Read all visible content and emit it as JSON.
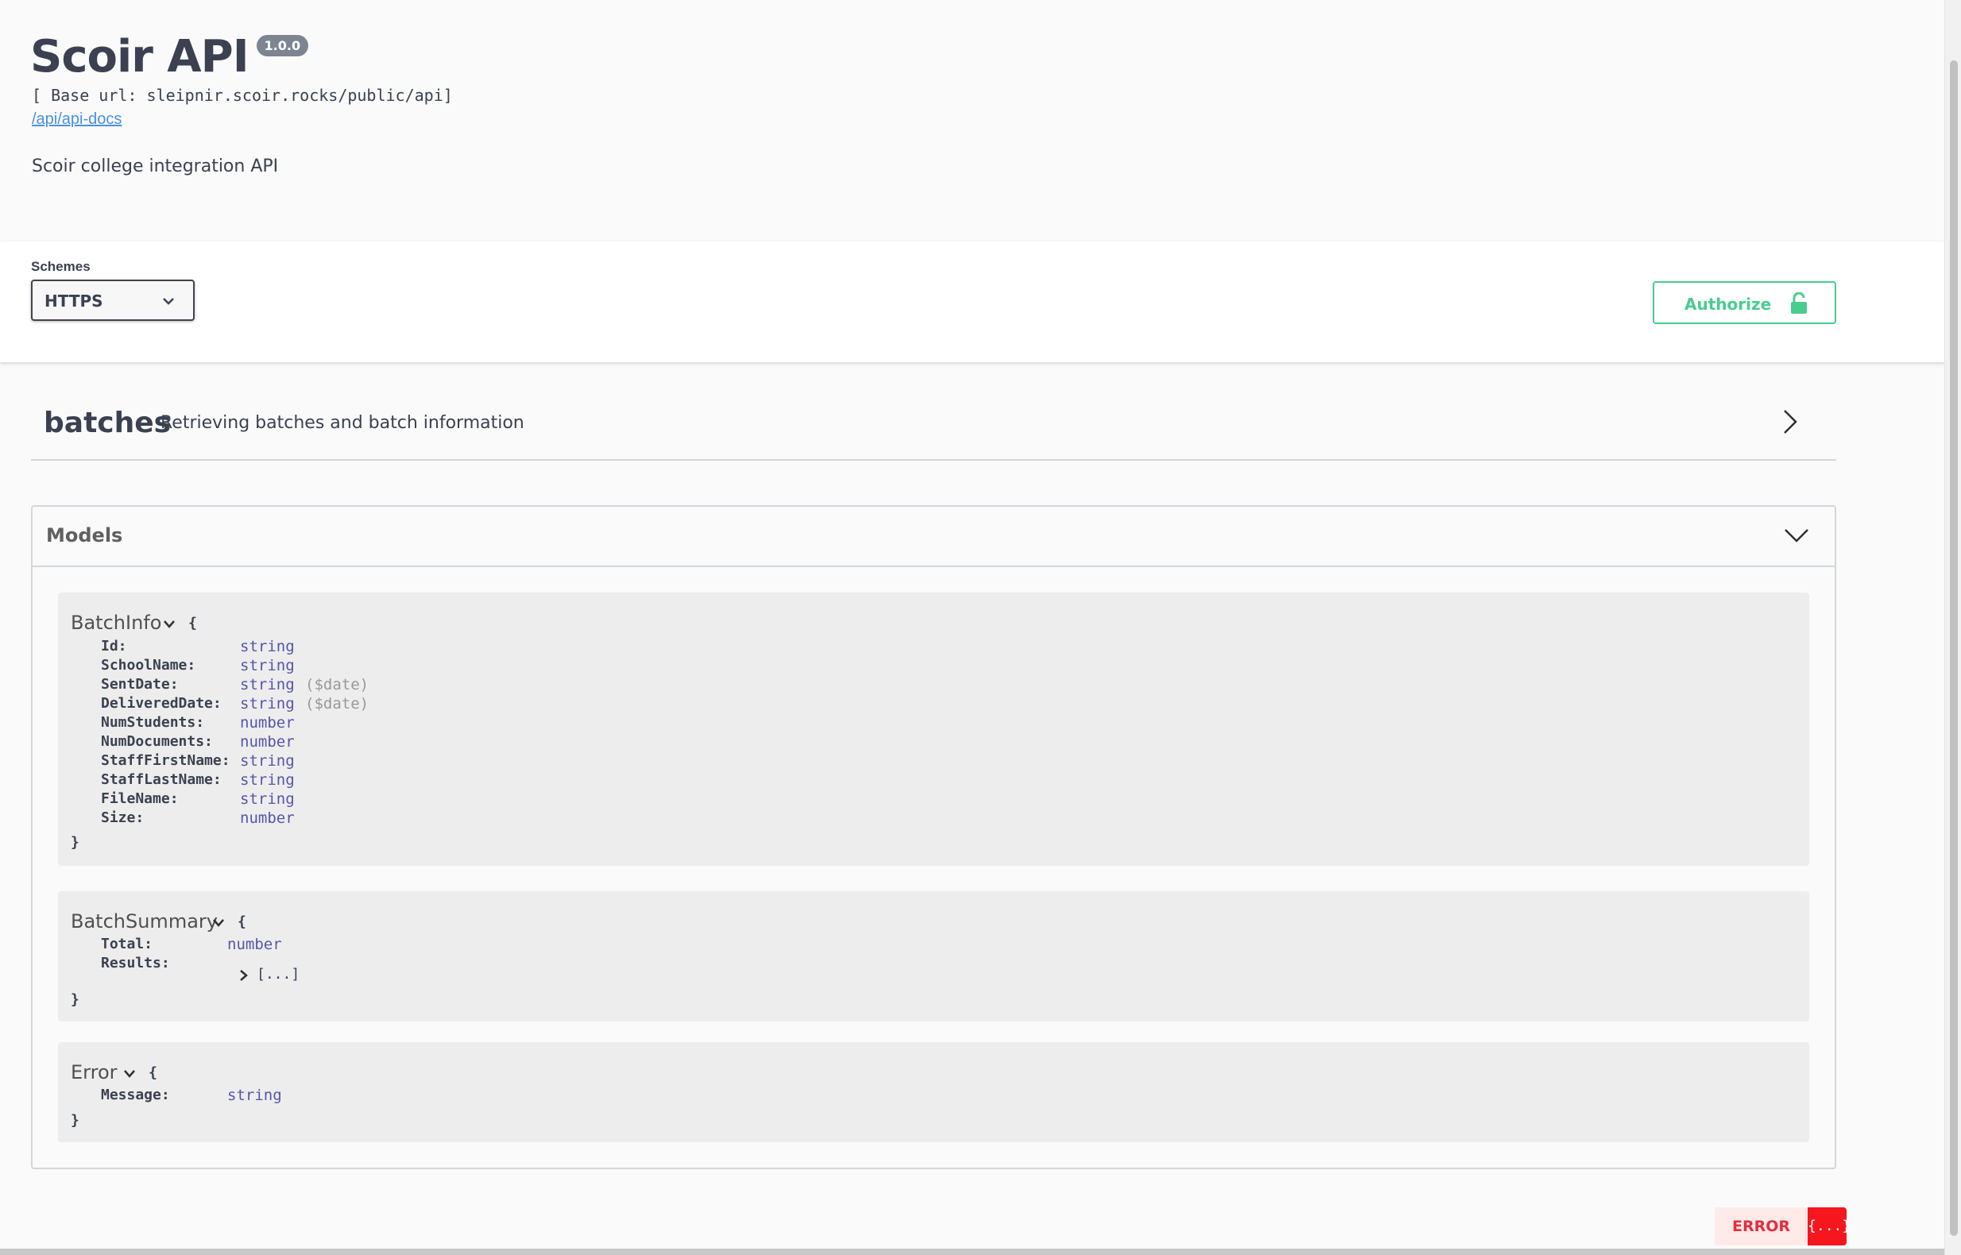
{
  "info": {
    "title": "Scoir API",
    "version": "1.0.0",
    "base_url": "[ Base url: sleipnir.scoir.rocks/public/api]",
    "docs_link": "/api/api-docs",
    "description": "Scoir college integration API"
  },
  "schemes": {
    "label": "Schemes",
    "selected": "HTTPS",
    "authorize_label": "Authorize"
  },
  "tag": {
    "name": "batches",
    "description": "Retrieving batches and batch information"
  },
  "models": {
    "title": "Models",
    "open_brace": "{",
    "close_brace": "}",
    "batch_info": {
      "name": "BatchInfo",
      "props": [
        {
          "name": "Id:",
          "type": "string",
          "format": ""
        },
        {
          "name": "SchoolName:",
          "type": "string",
          "format": ""
        },
        {
          "name": "SentDate:",
          "type": "string",
          "format": "($date)"
        },
        {
          "name": "DeliveredDate:",
          "type": "string",
          "format": "($date)"
        },
        {
          "name": "NumStudents:",
          "type": "number",
          "format": ""
        },
        {
          "name": "NumDocuments:",
          "type": "number",
          "format": ""
        },
        {
          "name": "StaffFirstName:",
          "type": "string",
          "format": ""
        },
        {
          "name": "StaffLastName:",
          "type": "string",
          "format": ""
        },
        {
          "name": "FileName:",
          "type": "string",
          "format": ""
        },
        {
          "name": "Size:",
          "type": "number",
          "format": ""
        }
      ]
    },
    "batch_summary": {
      "name": "BatchSummary",
      "props": [
        {
          "name": "Total:",
          "type": "number"
        },
        {
          "name": "Results:",
          "type": "[...]"
        }
      ]
    },
    "error": {
      "name": "Error",
      "props": [
        {
          "name": "Message:",
          "type": "string"
        }
      ]
    }
  },
  "validator": {
    "label": "ERROR",
    "icon": "{...}"
  },
  "colors": {
    "authorize": "#49cc90",
    "type": "#55a",
    "error": "#f5161e"
  }
}
